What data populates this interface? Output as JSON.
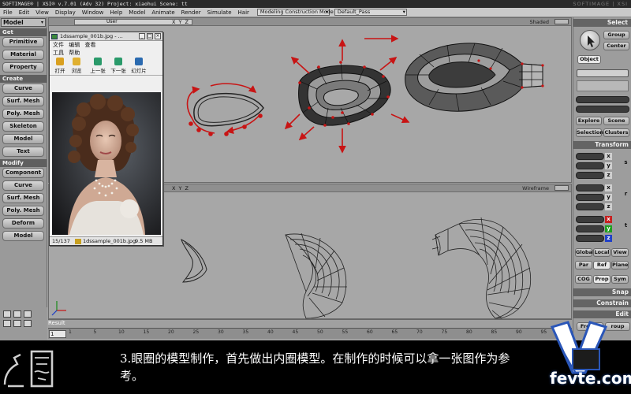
{
  "window": {
    "title": "SOFTIMAGE® | XSI® v.7.01 (Adv 32) Project: xiaohui    Scene: tt",
    "brand": "SOFTIMAGE | XSI"
  },
  "menubar": {
    "items": [
      "File",
      "Edit",
      "View",
      "Display",
      "Window",
      "Help",
      "Model",
      "Animate",
      "Render",
      "Simulate",
      "Hair"
    ],
    "construction_mode": "Modeling Construction Mode",
    "pass": "Default_Pass"
  },
  "left_toolbar": {
    "module": "Model",
    "sections": [
      {
        "label": "Get",
        "buttons": [
          "Primitive",
          "Material",
          "Property"
        ]
      },
      {
        "label": "Create",
        "buttons": [
          "Curve",
          "Surf. Mesh",
          "Poly. Mesh",
          "Skeleton",
          "Model",
          "Text"
        ]
      },
      {
        "label": "Modify",
        "buttons": [
          "Component",
          "Curve",
          "Surf. Mesh",
          "Poly. Mesh",
          "Deform",
          "Model"
        ]
      }
    ]
  },
  "viewport_top": {
    "camera": "User",
    "axes": "X Y Z",
    "display_mode": "Shaded"
  },
  "viewport_bottom": {
    "axes": "X Y Z",
    "display_mode": "Wireframe"
  },
  "timeline": {
    "result_label": "Result",
    "current_frame": "1",
    "ticks": [
      "1",
      "5",
      "10",
      "15",
      "20",
      "25",
      "30",
      "35",
      "40",
      "45",
      "50",
      "55",
      "60",
      "65",
      "70",
      "75",
      "80",
      "85",
      "90",
      "95"
    ]
  },
  "image_viewer": {
    "title": "1dssample_001b.jpg - ...",
    "menu": [
      "文件",
      "编辑",
      "查看",
      "工具",
      "帮助"
    ],
    "tools": [
      "打开",
      "浏览",
      "上一张",
      "下一张",
      "幻灯片"
    ],
    "status_index": "15/137",
    "status_file": "1dssample_001b.jpg",
    "status_size": "9.5 MB"
  },
  "right_panel": {
    "select_header": "Select",
    "select_buttons": [
      "Group",
      "Center"
    ],
    "object_label": "Object",
    "nav_buttons": [
      "Explore",
      "Scene",
      "Selection",
      "Clusters"
    ],
    "transform_header": "Transform",
    "axis_labels": [
      "x",
      "y",
      "z"
    ],
    "transform_rows": [
      "s",
      "r",
      "t"
    ],
    "space_buttons": [
      "Global",
      "Local",
      "View",
      "Par",
      "Ref",
      "Plane",
      "COG",
      "Prop",
      "Sym"
    ],
    "snap_header": "Snap",
    "constrain_header": "Constrain",
    "edit_header": "Edit",
    "freeze_label": "Freeze",
    "group_label": "roup"
  },
  "caption": {
    "text": "3.眼圈的模型制作，首先做出内圈模型。在制作的时候可以拿一张图作为参考。"
  },
  "watermark": {
    "text": "fevte.com"
  },
  "colors": {
    "ui_gray": "#a2a2a2",
    "arrow_red": "#c81414",
    "mesh_dark": "#3a3a3a",
    "mesh_light": "#9a9a9a",
    "caption_bg": "#000000"
  }
}
